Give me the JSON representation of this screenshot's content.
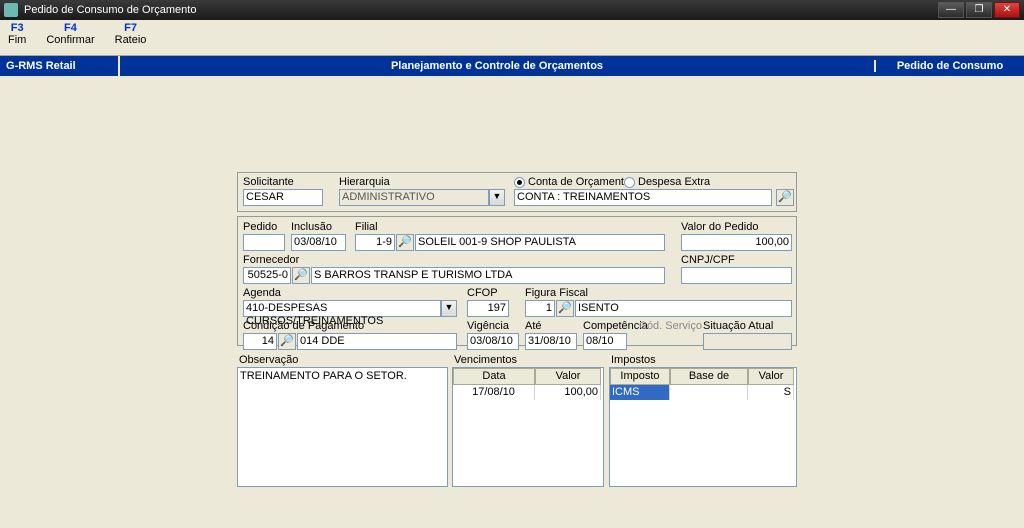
{
  "window": {
    "title": "Pedido de Consumo de Orçamento"
  },
  "shortcuts": [
    {
      "key": "F3",
      "label": "Fim"
    },
    {
      "key": "F4",
      "label": "Confirmar"
    },
    {
      "key": "F7",
      "label": "Rateio"
    }
  ],
  "bluebar": {
    "left": "G-RMS Retail",
    "mid": "Planejamento e Controle de Orçamentos",
    "right": "Pedido de Consumo"
  },
  "top": {
    "solicitante_label": "Solicitante",
    "solicitante_value": "CESAR",
    "hierarquia_label": "Hierarquia",
    "hierarquia_value": "ADMINISTRATIVO",
    "radio_conta_label": "Conta de Orçamento",
    "radio_extra_label": "Despesa Extra",
    "conta_value": "CONTA : TREINAMENTOS"
  },
  "mid": {
    "pedido_label": "Pedido",
    "pedido_value": "",
    "inclusao_label": "Inclusão",
    "inclusao_value": "03/08/10",
    "filial_label": "Filial",
    "filial_code": "1-9",
    "filial_desc": "SOLEIL 001-9 SHOP PAULISTA",
    "valor_pedido_label": "Valor do Pedido",
    "valor_pedido_value": "100,00",
    "fornecedor_label": "Fornecedor",
    "fornecedor_code": "50525-0",
    "fornecedor_desc": "S BARROS TRANSP E TURISMO LTDA",
    "cnpj_label": "CNPJ/CPF",
    "cnpj_value": "",
    "agenda_label": "Agenda",
    "agenda_value": "410-DESPESAS CURSOS/TREINAMENTOS",
    "cfop_label": "CFOP",
    "cfop_value": "197",
    "figura_label": "Figura Fiscal",
    "figura_code": "1",
    "figura_desc": "ISENTO",
    "cond_label": "Condição de Pagamento",
    "cond_code": "14",
    "cond_desc": "014 DDE",
    "vigencia_label": "Vigência",
    "vigencia_value": "03/08/10",
    "ate_label": "Até",
    "ate_value": "31/08/10",
    "competencia_label": "Competência",
    "competencia_value": "08/10",
    "cod_servico_label": "Cód. Serviço",
    "situacao_label": "Situação Atual"
  },
  "bottom": {
    "obs_label": "Observação",
    "obs_value": "TREINAMENTO PARA O SETOR.",
    "venc_label": "Vencimentos",
    "venc_headers": [
      "Data",
      "Valor"
    ],
    "venc_row": [
      "17/08/10",
      "100,00"
    ],
    "imp_label": "Impostos",
    "imp_headers": [
      "Imposto",
      "Base de Cálculo",
      "Valor"
    ],
    "imp_row": [
      "ICMS",
      "",
      "S"
    ]
  }
}
